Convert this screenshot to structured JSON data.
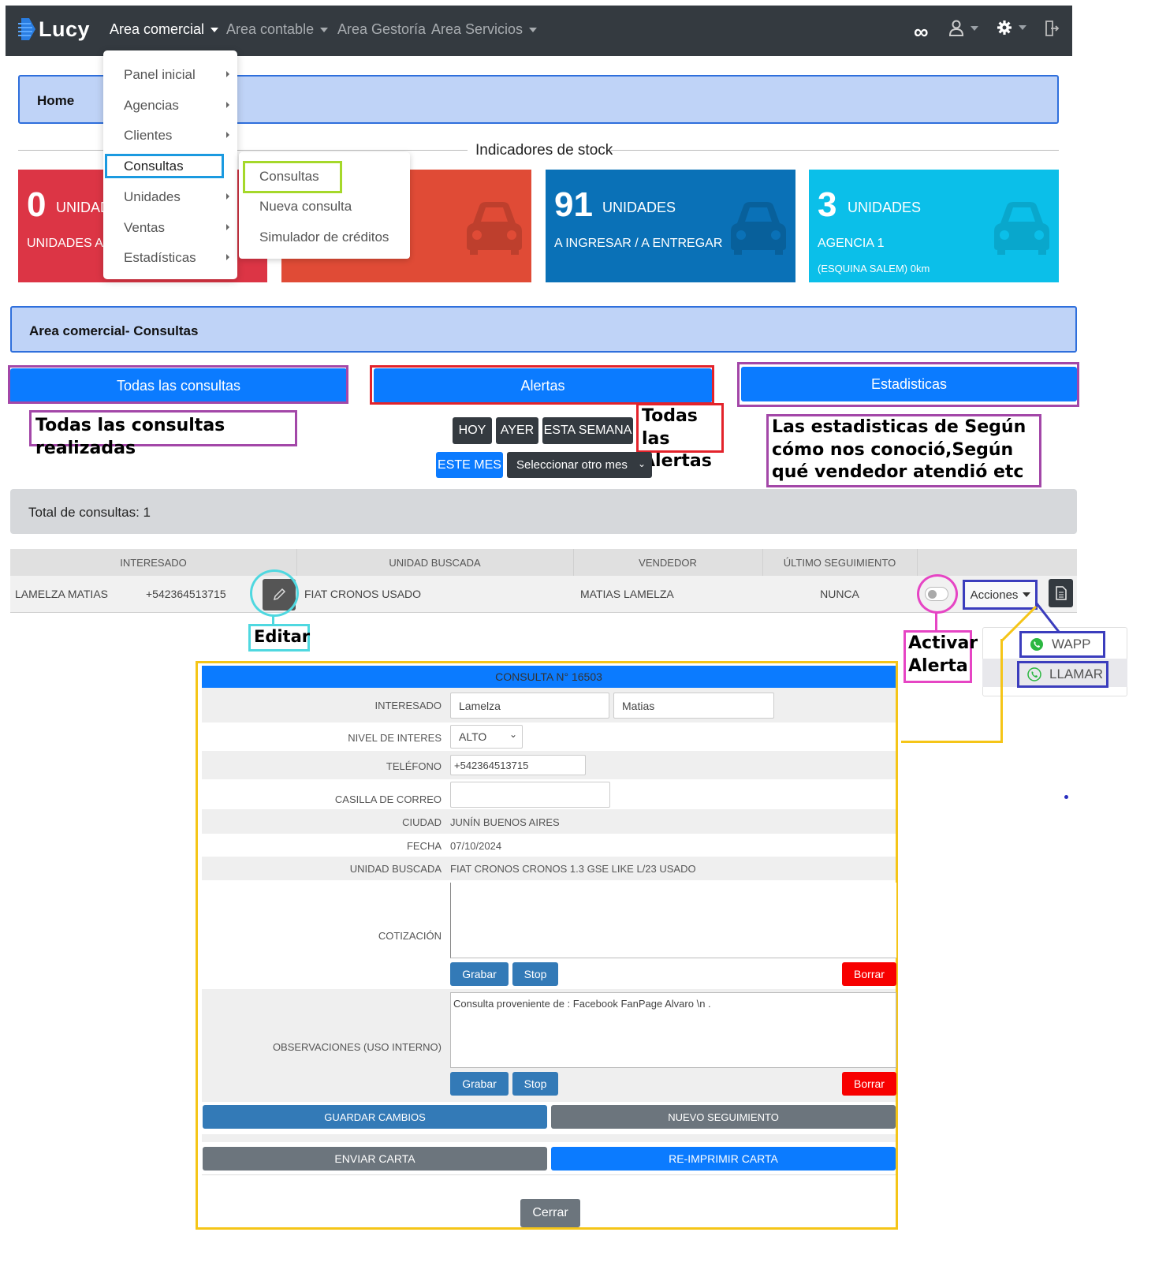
{
  "navbar": {
    "brand": "Lucy",
    "items": [
      {
        "label": "Area comercial",
        "active": true,
        "has_caret": true
      },
      {
        "label": "Area contable",
        "active": false,
        "has_caret": true
      },
      {
        "label": "Area Gestoría",
        "active": false,
        "has_caret": false
      },
      {
        "label": "Area Servicios",
        "active": false,
        "has_caret": true
      }
    ],
    "right_icons": [
      "infinity-icon",
      "user-icon",
      "gear-icon",
      "logout-icon"
    ]
  },
  "menu": {
    "items": [
      "Panel inicial",
      "Agencias",
      "Clientes",
      "Consultas",
      "Unidades",
      "Ventas",
      "Estadísticas"
    ],
    "highlighted": "Consultas",
    "submenu": [
      "Consultas",
      "Nueva consulta",
      "Simulador de créditos"
    ]
  },
  "breadcrumb": "Home",
  "stock": {
    "title": "Indicadores de stock",
    "cards": [
      {
        "number": "0",
        "unit": "UNIDADES",
        "subtitle": "UNIDADES A",
        "color": "#dc3545"
      },
      {
        "number": "",
        "unit": "",
        "subtitle": "",
        "color": "#e04b36"
      },
      {
        "number": "91",
        "unit": "UNIDADES",
        "subtitle": "A INGRESAR / A ENTREGAR",
        "color": "#0a71b7"
      },
      {
        "number": "3",
        "unit": "UNIDADES",
        "subtitle": "AGENCIA 1",
        "detail": "(ESQUINA SALEM) 0km",
        "color": "#0bbfe9"
      }
    ]
  },
  "section_title": "Area comercial- Consultas",
  "tabs": {
    "todas": "Todas las consultas",
    "alertas": "Alertas",
    "estadisticas": "Estadisticas"
  },
  "annotations": {
    "todas": "Todas las consultas realizadas",
    "alertas": "Todas las Alertas",
    "estadisticas": "Las estadisticas de Según cómo nos conoció,Según qué vendedor atendió etc",
    "editar": "Editar",
    "activar": "Activar Alerta"
  },
  "filters": {
    "hoy": "HOY",
    "ayer": "AYER",
    "semana": "ESTA SEMANA",
    "mes": "ESTE MES",
    "select_mes": "Seleccionar otro mes"
  },
  "total": "Total de consultas: 1",
  "table": {
    "headers": [
      "INTERESADO",
      "UNIDAD BUSCADA",
      "VENDEDOR",
      "ÚLTIMO SEGUIMIENTO"
    ],
    "rows": [
      {
        "name": "LAMELZA MATIAS",
        "phone": "+542364513715",
        "unidad": "FIAT CRONOS USADO",
        "vendedor": "MATIAS LAMELZA",
        "seguimiento": "NUNCA",
        "alerta_activa": false
      }
    ],
    "acciones_label": "Acciones",
    "acciones_menu": [
      "WAPP",
      "LLAMAR"
    ]
  },
  "modal": {
    "title": "CONSULTA N° 16503",
    "fields": {
      "interesado_label": "INTERESADO",
      "apellido": "Lamelza",
      "nombre": "Matias",
      "nivel_label": "NIVEL DE INTERES",
      "nivel": "ALTO",
      "telefono_label": "TELÉFONO",
      "telefono": "+542364513715",
      "correo_label": "CASILLA DE CORREO",
      "correo": "",
      "ciudad_label": "CIUDAD",
      "ciudad": "JUNÍN BUENOS AIRES",
      "fecha_label": "FECHA",
      "fecha": "07/10/2024",
      "unidad_label": "UNIDAD BUSCADA",
      "unidad": "FIAT CRONOS CRONOS 1.3 GSE LIKE L/23 USADO",
      "cotizacion_label": "COTIZACIÓN",
      "cotizacion": "",
      "observaciones_label": "OBSERVACIONES (USO INTERNO)",
      "observaciones": "Consulta proveniente de : Facebook FanPage Alvaro \\n ."
    },
    "buttons": {
      "grabar": "Grabar",
      "stop": "Stop",
      "borrar": "Borrar",
      "guardar": "GUARDAR CAMBIOS",
      "nuevo_seguimiento": "NUEVO SEGUIMIENTO",
      "enviar_carta": "ENVIAR CARTA",
      "reimprimir_carta": "RE-IMPRIMIR CARTA",
      "cerrar": "Cerrar"
    }
  }
}
